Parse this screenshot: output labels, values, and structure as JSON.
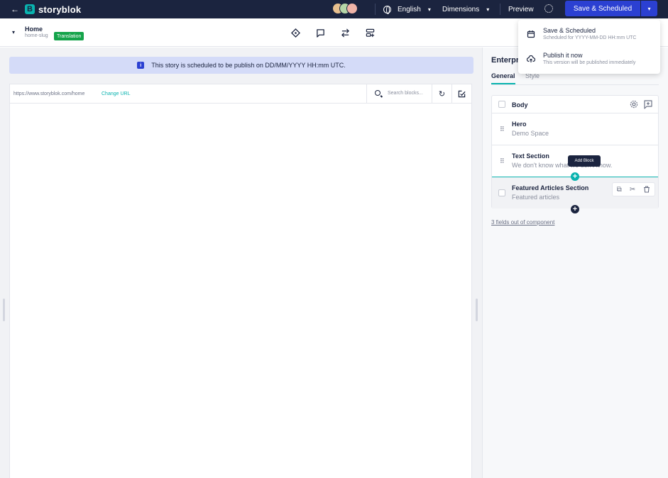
{
  "topbar": {
    "back_glyph": "←",
    "logo_mark": "B",
    "brand": "storyblok",
    "language": "English",
    "dimensions": "Dimensions",
    "preview": "Preview",
    "save_label": "Save & Scheduled",
    "avatar_colors": [
      "#e8c08f",
      "#b6d6a8",
      "#f0b4a8"
    ]
  },
  "story": {
    "name": "Home",
    "slug": "home-slug",
    "badge": "Translation"
  },
  "notice": {
    "icon": "i",
    "text": "This story is scheduled to be publish on DD/MM/YYYY HH:mm UTC."
  },
  "urlbar": {
    "url": "https://www.storyblok.com/home",
    "change_url": "Change URL",
    "search_placeholder": "Search blocks..."
  },
  "panel": {
    "title": "Enterpr",
    "tabs": [
      {
        "label": "General"
      },
      {
        "label": "Style"
      }
    ],
    "body_label": "Body",
    "blocks": [
      {
        "title": "Hero",
        "subtitle": "Demo Space"
      },
      {
        "title": "Text Section",
        "subtitle": "We don't know what we don't know."
      },
      {
        "title": "Featured Articles Section",
        "subtitle": "Featured articles"
      }
    ],
    "add_block_tooltip": "Add Block",
    "fields_link": "3 fields out of component"
  },
  "dropdown": {
    "items": [
      {
        "title": "Save & Scheduled",
        "subtitle": "Scheduled for YYYY-MM-DD HH:mm UTC",
        "icon": "calendar-icon"
      },
      {
        "title": "Publish it now",
        "subtitle": "This version will be published immediately",
        "icon": "cloud-upload-icon"
      }
    ]
  },
  "colors": {
    "navy": "#1b243f",
    "primary": "#2b40d2",
    "teal": "#09b3af",
    "badge_green": "#14a34a",
    "notice_bg": "#d4dbf8"
  }
}
